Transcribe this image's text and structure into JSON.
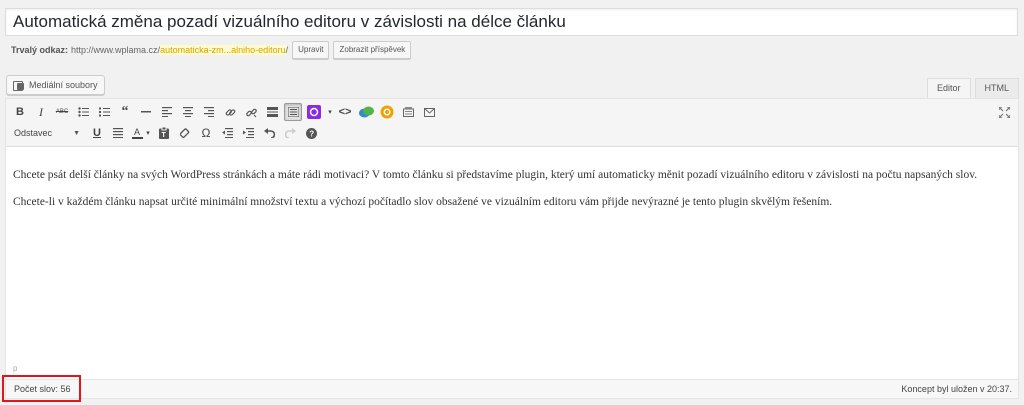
{
  "post": {
    "title": "Automatická změna pozadí vizuálního editoru v závislosti na délce článku"
  },
  "permalink": {
    "label": "Trvalý odkaz:",
    "base": "http://www.wplama.cz/",
    "slug": "automaticka-zm...alniho-editoru",
    "trail": "/",
    "edit_label": "Upravit",
    "view_label": "Zobrazit příspěvek"
  },
  "media": {
    "button_label": "Mediální soubory",
    "icon": "media-icon"
  },
  "tabs": {
    "editor": "Editor",
    "html": "HTML"
  },
  "toolbar": {
    "row1_icons": [
      "bold-icon",
      "italic-icon",
      "strikethrough-icon",
      "bullet-list-icon",
      "numbered-list-icon",
      "blockquote-icon",
      "horizontal-rule-icon",
      "align-left-icon",
      "align-center-icon",
      "align-right-icon",
      "link-icon",
      "unlink-icon",
      "more-tag-icon",
      "toolbar-toggle-icon",
      "plugin-purple-icon",
      "code-icon",
      "speech-bubble-icon",
      "plugin-orange-icon",
      "page-icon",
      "mail-icon"
    ],
    "row2_icons": [
      "underline-icon",
      "justify-icon",
      "text-color-icon",
      "paste-text-icon",
      "clear-format-icon",
      "special-char-icon",
      "outdent-icon",
      "indent-icon",
      "undo-icon",
      "redo-icon",
      "help-icon"
    ],
    "format_value": "Odstavec",
    "colors": {
      "plugin_purple": "#8a2be2",
      "plugin_orange": "#f0a000",
      "bubble_blue": "#2e8bd6",
      "bubble_green": "#52b34a"
    }
  },
  "content": {
    "paragraphs": [
      "Chcete psát delší články na svých WordPress stránkách a máte rádi motivaci? V tomto článku si představíme plugin, který umí automaticky měnit pozadí vizuálního editoru v závislosti na počtu napsaných slov.",
      "Chcete-li v každém článku napsat určité minimální množství textu a výchozí počítadlo slov obsažené ve vizuálním editoru vám přijde nevýrazné je tento plugin skvělým řešením."
    ],
    "path": "p"
  },
  "status": {
    "word_count": "Počet slov: 56",
    "draft_saved": "Koncept byl uložen v 20:37."
  },
  "highlight_color": "#e3141c"
}
